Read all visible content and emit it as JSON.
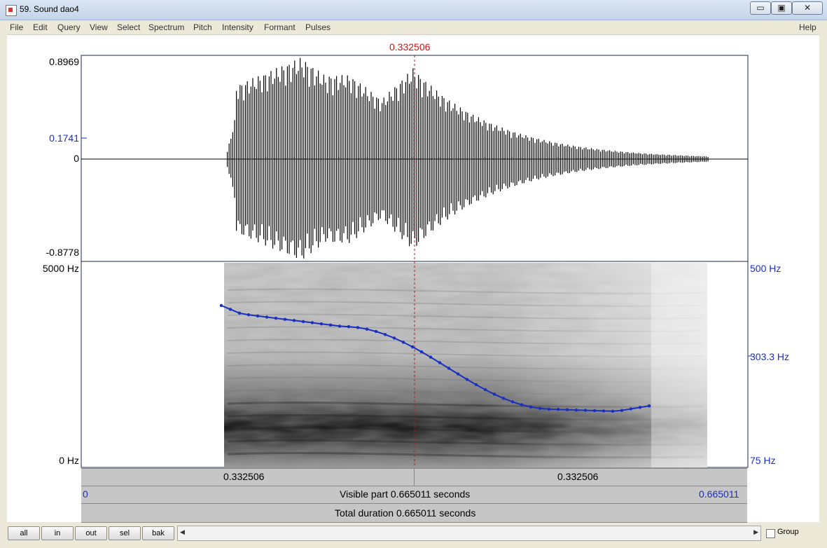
{
  "window": {
    "title": "59. Sound dao4",
    "controls": [
      "▭",
      "▣",
      "✕"
    ]
  },
  "menu": [
    "File",
    "Edit",
    "Query",
    "View",
    "Select",
    "Spectrum",
    "Pitch",
    "Intensity",
    "Formant",
    "Pulses",
    "Help"
  ],
  "cursor": {
    "time_label": "0.332506"
  },
  "waveform": {
    "y_max": "0.8969",
    "y_cursor": "0.1741",
    "y_zero": "0",
    "y_min": "-0.8778"
  },
  "spectrogram": {
    "freq_top": "5000 Hz",
    "freq_bottom": "0 Hz"
  },
  "pitch": {
    "top": "500 Hz",
    "mid": "303.3 Hz",
    "bottom": "75 Hz",
    "line_color": "#1a2fbf"
  },
  "time_bars": {
    "left_segment": "0.332506",
    "right_segment": "0.332506",
    "visible_start": "0",
    "visible_text": "Visible part 0.665011 seconds",
    "visible_end": "0.665011",
    "total_text": "Total duration 0.665011 seconds"
  },
  "buttons": {
    "all": "all",
    "in": "in",
    "out": "out",
    "sel": "sel",
    "bak": "bak"
  },
  "scrollbar": {
    "left_arrow": "◀",
    "right_arrow": "▶"
  },
  "group": {
    "label": "Group",
    "checked": false
  }
}
